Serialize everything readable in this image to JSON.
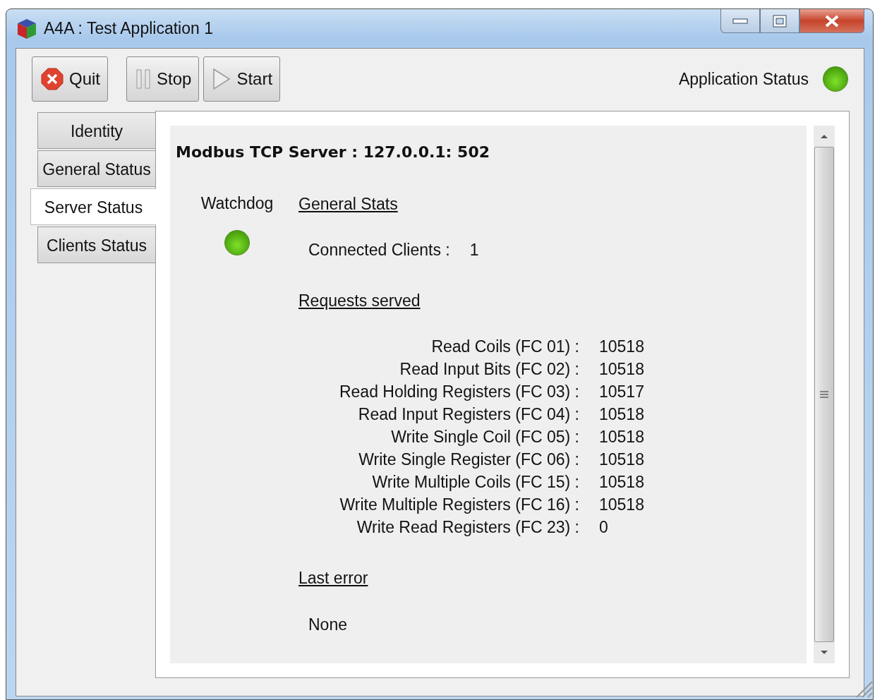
{
  "window": {
    "title": "A4A : Test Application 1"
  },
  "toolbar": {
    "buttons": [
      {
        "label": "Quit",
        "kind": "quit"
      },
      {
        "label": "Stop",
        "kind": "stop"
      },
      {
        "label": "Start",
        "kind": "start"
      }
    ],
    "application_status": {
      "label": "Application Status",
      "on": true
    }
  },
  "tabs": [
    {
      "label": "Identity",
      "selected": false
    },
    {
      "label": "General Status",
      "selected": false
    },
    {
      "label": "Server Status",
      "selected": true
    },
    {
      "label": "Clients Status",
      "selected": false
    }
  ],
  "server": {
    "title": "Modbus TCP Server : 127.0.0.1: 502",
    "watchdog": {
      "label": "Watchdog",
      "on": true
    },
    "general_stats": {
      "heading": "General Stats",
      "connected_clients_label": "Connected Clients :",
      "connected_clients": "1"
    },
    "requests_heading": "Requests served",
    "requests": [
      {
        "label": "Read Coils (FC 01) :",
        "value": "10518"
      },
      {
        "label": "Read Input Bits (FC 02) :",
        "value": "10518"
      },
      {
        "label": "Read Holding Registers (FC 03) :",
        "value": "10517"
      },
      {
        "label": "Read Input Registers (FC 04) :",
        "value": "10518"
      },
      {
        "label": "Write Single Coil (FC 05) :",
        "value": "10518"
      },
      {
        "label": "Write Single Register (FC 06) :",
        "value": "10518"
      },
      {
        "label": "Write Multiple Coils (FC 15) :",
        "value": "10518"
      },
      {
        "label": "Write Multiple Registers (FC 16) :",
        "value": "10518"
      },
      {
        "label": "Write Read Registers (FC 23) :",
        "value": "0"
      }
    ],
    "last_error_heading": "Last error",
    "last_error": "None"
  }
}
